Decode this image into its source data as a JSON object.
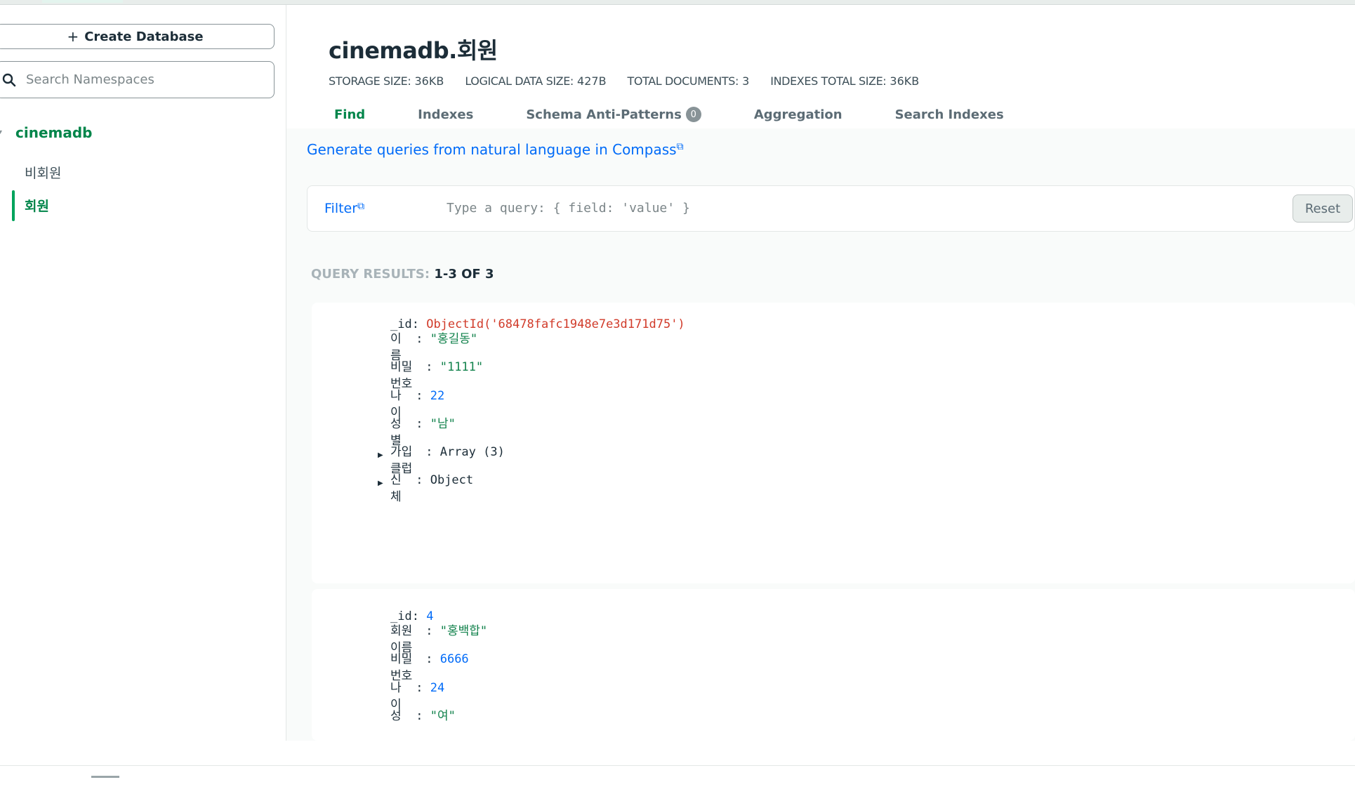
{
  "sidebar": {
    "create_database_label": "Create Database",
    "search_placeholder": "Search Namespaces",
    "database": "cinemadb",
    "collections": [
      "비회원",
      "회원"
    ]
  },
  "header": {
    "title": "cinemadb.회원",
    "stats": [
      {
        "label": "STORAGE SIZE:",
        "value": "36KB"
      },
      {
        "label": "LOGICAL DATA SIZE:",
        "value": "427B"
      },
      {
        "label": "TOTAL DOCUMENTS:",
        "value": "3"
      },
      {
        "label": "INDEXES TOTAL SIZE:",
        "value": "36KB"
      }
    ]
  },
  "tabs": [
    {
      "label": "Find"
    },
    {
      "label": "Indexes"
    },
    {
      "label": "Schema Anti-Patterns",
      "count": "0"
    },
    {
      "label": "Aggregation"
    },
    {
      "label": "Search Indexes"
    }
  ],
  "nl_link": "Generate queries from natural language in Compass",
  "filter": {
    "label": "Filter",
    "placeholder": "Type a query: { field: 'value' }",
    "reset_label": "Reset"
  },
  "query_results": {
    "label": "QUERY RESULTS:",
    "value": "1-3 OF 3"
  },
  "documents": [
    {
      "fields": [
        {
          "key": "_id",
          "value": "ObjectId('68478fafc1948e7e3d171d75')"
        },
        {
          "key": "이름",
          "value": "\"홍길동\""
        },
        {
          "key": "비밀번호",
          "value": "\"1111\""
        },
        {
          "key": "나이",
          "value": "22"
        },
        {
          "key": "성별",
          "value": "\"남\""
        },
        {
          "key": "가입클럽",
          "value": "Array (3)"
        },
        {
          "key": "신체",
          "value": "Object"
        }
      ]
    },
    {
      "fields": [
        {
          "key": "_id",
          "value": "4"
        },
        {
          "key": "회원이름",
          "value": "\"홍백합\""
        },
        {
          "key": "비밀번호",
          "value": "6666"
        },
        {
          "key": "나이",
          "value": "24"
        },
        {
          "key": "성",
          "value": "\"여\""
        }
      ]
    }
  ]
}
